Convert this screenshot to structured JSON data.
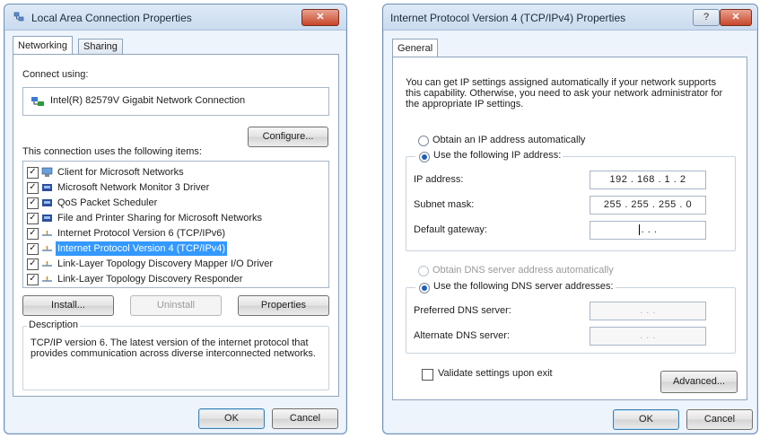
{
  "lan_dialog": {
    "title": "Local Area Connection Properties",
    "close_label": "✕",
    "tabs": [
      {
        "label": "Networking"
      },
      {
        "label": "Sharing"
      }
    ],
    "connect_using_label": "Connect using:",
    "adapter_name": "Intel(R) 82579V Gigabit Network Connection",
    "configure_button": "Configure...",
    "items_label": "This connection uses the following items:",
    "items": [
      {
        "label": "Client for Microsoft Networks",
        "checked": true,
        "icon": "network-client-icon"
      },
      {
        "label": "Microsoft Network Monitor 3 Driver",
        "checked": true,
        "icon": "network-service-icon"
      },
      {
        "label": "QoS Packet Scheduler",
        "checked": true,
        "icon": "network-service-icon"
      },
      {
        "label": "File and Printer Sharing for Microsoft Networks",
        "checked": true,
        "icon": "network-service-icon"
      },
      {
        "label": "Internet Protocol Version 6 (TCP/IPv6)",
        "checked": true,
        "icon": "protocol-icon"
      },
      {
        "label": "Internet Protocol Version 4 (TCP/IPv4)",
        "checked": true,
        "icon": "protocol-icon",
        "selected": true
      },
      {
        "label": "Link-Layer Topology Discovery Mapper I/O Driver",
        "checked": true,
        "icon": "protocol-icon"
      },
      {
        "label": "Link-Layer Topology Discovery Responder",
        "checked": true,
        "icon": "protocol-icon"
      }
    ],
    "install_button": "Install...",
    "uninstall_button": "Uninstall",
    "properties_button": "Properties",
    "description_title": "Description",
    "description_text": "TCP/IP version 6. The latest version of the internet protocol that provides communication across diverse interconnected networks.",
    "ok_button": "OK",
    "cancel_button": "Cancel"
  },
  "ipv4_dialog": {
    "title": "Internet Protocol Version 4 (TCP/IPv4) Properties",
    "help_label": "?",
    "close_label": "✕",
    "tabs": [
      {
        "label": "General"
      }
    ],
    "intro_text": "You can get IP settings assigned automatically if your network supports this capability. Otherwise, you need to ask your network administrator for the appropriate IP settings.",
    "radio_auto_ip": "Obtain an IP address automatically",
    "radio_manual_ip": "Use the following IP address:",
    "ip_address_label": "IP address:",
    "ip_address_value": "192 . 168 . 1 . 2",
    "subnet_mask_label": "Subnet mask:",
    "subnet_mask_value": "255 . 255 . 255 . 0",
    "default_gateway_label": "Default gateway:",
    "default_gateway_value": ". . .",
    "radio_auto_dns": "Obtain DNS server address automatically",
    "radio_manual_dns": "Use the following DNS server addresses:",
    "preferred_dns_label": "Preferred DNS server:",
    "preferred_dns_value": ". . .",
    "alternate_dns_label": "Alternate DNS server:",
    "alternate_dns_value": ". . .",
    "validate_label": "Validate settings upon exit",
    "validate_checked": false,
    "advanced_button": "Advanced...",
    "ok_button": "OK",
    "cancel_button": "Cancel"
  },
  "colors": {
    "selection": "#3399ff",
    "close_button": "#c8462a",
    "window_border": "#6f8fb6"
  }
}
